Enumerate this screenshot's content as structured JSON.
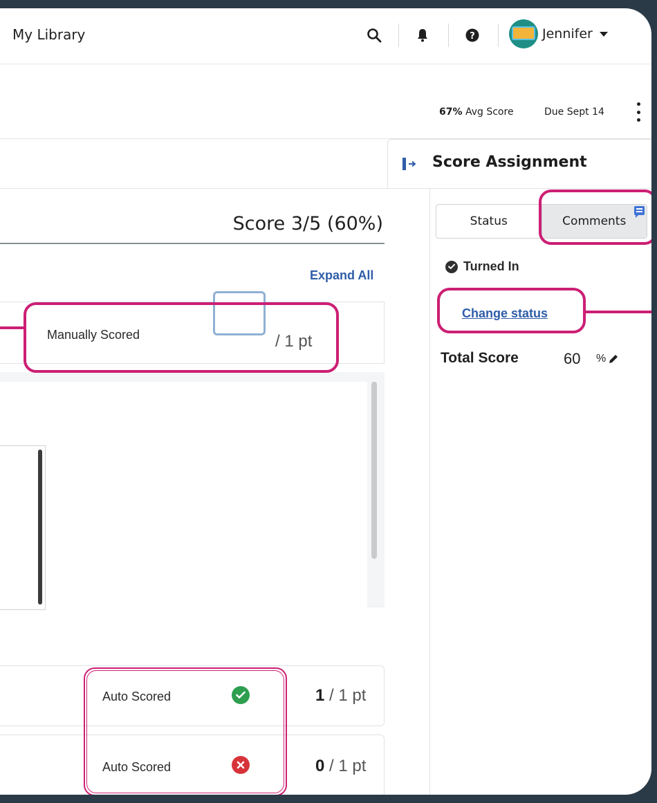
{
  "topbar": {
    "title": "My Library",
    "user_name": "Jennifer",
    "icons": [
      "search-icon",
      "bell-icon",
      "help-icon"
    ]
  },
  "summary": {
    "avg_value": "67%",
    "avg_label": "Avg Score",
    "due": "Due Sept 14"
  },
  "main": {
    "score_title": "Score 3/5 (60%)",
    "expand_all": "Expand All",
    "questions": [
      {
        "label": "Manually Scored",
        "score": "",
        "pts": "/ 1 pt"
      },
      {
        "label": "Auto Scored",
        "score": "1",
        "pts": "/ 1 pt",
        "result": "correct"
      },
      {
        "label": "Auto Scored",
        "score": "0",
        "pts": "/ 1 pt",
        "result": "incorrect"
      }
    ]
  },
  "panel": {
    "title": "Score Assignment",
    "tabs": [
      "Status",
      "Comments"
    ],
    "active_tab": "Comments",
    "status": "Turned In",
    "change_status": "Change status",
    "total_label": "Total Score",
    "total_value": "60",
    "total_unit": "%"
  },
  "colors": {
    "accent_link": "#2f5da8",
    "callout": "#cc1f74",
    "correct": "#2e9e4f",
    "incorrect": "#d7343a"
  }
}
